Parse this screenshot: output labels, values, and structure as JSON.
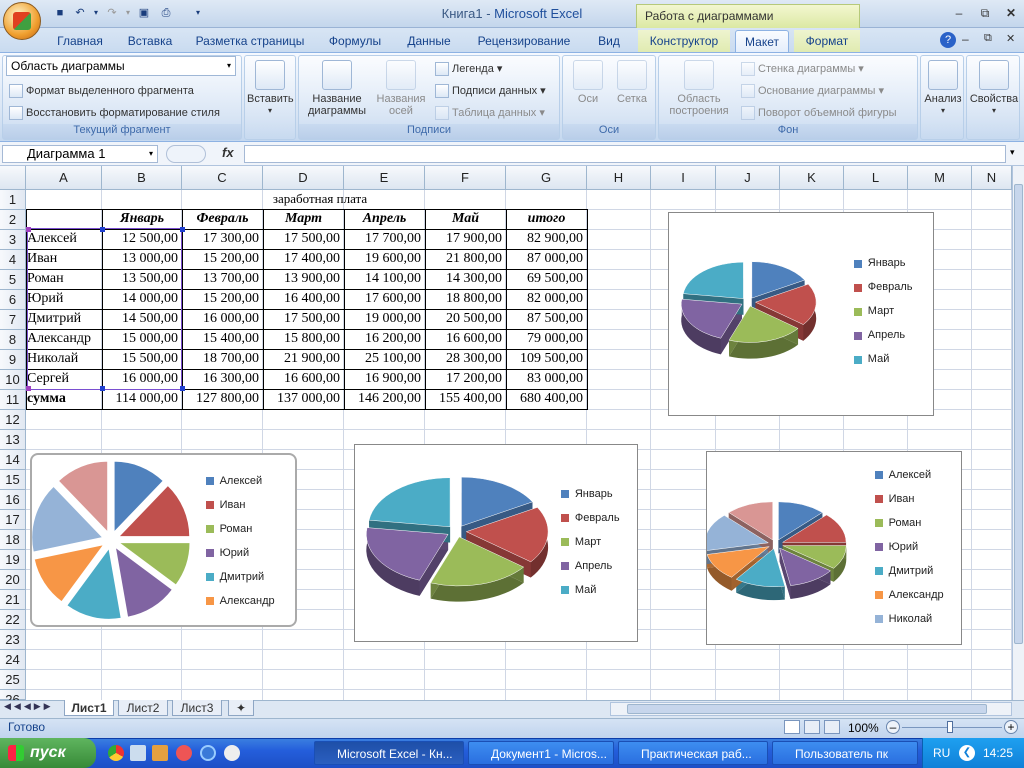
{
  "window": {
    "doc": "Книга1",
    "sep": " - ",
    "app": "Microsoft Excel",
    "context_title": "Работа с диаграммами"
  },
  "tabs": [
    "Главная",
    "Вставка",
    "Разметка страницы",
    "Формулы",
    "Данные",
    "Рецензирование",
    "Вид",
    "Конструктор",
    "Макет",
    "Формат"
  ],
  "ribbon": {
    "current": {
      "combo": "Область диаграммы",
      "format_sel": "Формат выделенного фрагмента",
      "reset_style": "Восстановить форматирование стиля",
      "label": "Текущий фрагмент"
    },
    "insert": {
      "label": "Вставить"
    },
    "labels": {
      "chart_title": "Название\nдиаграммы",
      "axis_titles": "Названия\nосей",
      "legend": "Легенда",
      "data_labels": "Подписи данных",
      "data_table": "Таблица данных",
      "group": "Подписи"
    },
    "axes": {
      "axes": "Оси",
      "grid": "Сетка",
      "group": "Оси"
    },
    "background": {
      "plot_area": "Область\nпостроения",
      "wall": "Стенка диаграммы",
      "floor": "Основание диаграммы",
      "rotation": "Поворот объемной фигуры",
      "group": "Фон"
    },
    "analysis": "Анализ",
    "properties": "Свойства"
  },
  "namebox": "Диаграмма 1",
  "columns": [
    "A",
    "B",
    "C",
    "D",
    "E",
    "F",
    "G",
    "H",
    "I",
    "J",
    "K",
    "L",
    "M",
    "N"
  ],
  "rows": [
    "1",
    "2",
    "3",
    "4",
    "5",
    "6",
    "7",
    "8",
    "9",
    "10",
    "11",
    "12",
    "13",
    "14",
    "15",
    "16",
    "17",
    "18",
    "19",
    "20",
    "21",
    "22",
    "23",
    "24",
    "25",
    "26"
  ],
  "sheet": {
    "title": "заработная плата",
    "headers": [
      "Январь",
      "Февраль",
      "Март",
      "Апрель",
      "Май",
      "итого"
    ],
    "data": [
      [
        "Алексей",
        "12 500,00",
        "17 300,00",
        "17 500,00",
        "17 700,00",
        "17 900,00",
        "82 900,00"
      ],
      [
        "Иван",
        "13 000,00",
        "15 200,00",
        "17 400,00",
        "19 600,00",
        "21 800,00",
        "87 000,00"
      ],
      [
        "Роман",
        "13 500,00",
        "13 700,00",
        "13 900,00",
        "14 100,00",
        "14 300,00",
        "69 500,00"
      ],
      [
        "Юрий",
        "14 000,00",
        "15 200,00",
        "16 400,00",
        "17 600,00",
        "18 800,00",
        "82 000,00"
      ],
      [
        "Дмитрий",
        "14 500,00",
        "16 000,00",
        "17 500,00",
        "19 000,00",
        "20 500,00",
        "87 500,00"
      ],
      [
        "Александр",
        "15 000,00",
        "15 400,00",
        "15 800,00",
        "16 200,00",
        "16 600,00",
        "79 000,00"
      ],
      [
        "Николай",
        "15 500,00",
        "18 700,00",
        "21 900,00",
        "25 100,00",
        "28 300,00",
        "109 500,00"
      ],
      [
        "Сергей",
        "16 000,00",
        "16 300,00",
        "16 600,00",
        "16 900,00",
        "17 200,00",
        "83 000,00"
      ]
    ],
    "sum": [
      "сумма",
      "114 000,00",
      "127 800,00",
      "137 000,00",
      "146 200,00",
      "155 400,00",
      "680 400,00"
    ]
  },
  "colors": {
    "c1": "#4f81bd",
    "c2": "#c0504d",
    "c3": "#9bbb59",
    "c4": "#8064a2",
    "c5": "#4bacc6",
    "c6": "#f79646",
    "c7": "#95b3d7",
    "c8": "#d99694"
  },
  "chart_data": [
    {
      "type": "pie",
      "categories": [
        "Январь",
        "Февраль",
        "Март",
        "Апрель",
        "Май"
      ],
      "values": [
        114000,
        127800,
        137000,
        146200,
        155400
      ],
      "legend": "right",
      "exploded": true,
      "style": "3d"
    },
    {
      "type": "pie",
      "categories": [
        "Алексей",
        "Иван",
        "Роман",
        "Юрий",
        "Дмитрий",
        "Александр",
        "Николай",
        "Сергей"
      ],
      "values": [
        82900,
        87000,
        69500,
        82000,
        87500,
        79000,
        109500,
        83000
      ],
      "legend_visible": [
        "Алексей",
        "Иван",
        "Роман",
        "Юрий",
        "Дмитрий",
        "Александр"
      ],
      "legend": "right",
      "exploded": true
    },
    {
      "type": "pie",
      "categories": [
        "Январь",
        "Февраль",
        "Март",
        "Апрель",
        "Май"
      ],
      "values": [
        114000,
        127800,
        137000,
        146200,
        155400
      ],
      "legend": "right",
      "exploded": true,
      "style": "3d"
    },
    {
      "type": "pie",
      "categories": [
        "Алексей",
        "Иван",
        "Роман",
        "Юрий",
        "Дмитрий",
        "Александр",
        "Николай",
        "Сергей"
      ],
      "values": [
        82900,
        87000,
        69500,
        82000,
        87500,
        79000,
        109500,
        83000
      ],
      "legend_visible": [
        "Алексей",
        "Иван",
        "Роман",
        "Юрий",
        "Дмитрий",
        "Александр",
        "Николай"
      ],
      "legend": "right",
      "exploded": true,
      "style": "3d"
    }
  ],
  "sheet_tabs": [
    "Лист1",
    "Лист2",
    "Лист3"
  ],
  "status": {
    "ready": "Готово",
    "zoom": "100%"
  },
  "taskbar": {
    "start": "пуск",
    "items": [
      "Microsoft Excel - Кн...",
      "Документ1 - Micros...",
      "Практическая раб...",
      "Пользователь пк"
    ],
    "lang": "RU",
    "time": "14:25"
  }
}
